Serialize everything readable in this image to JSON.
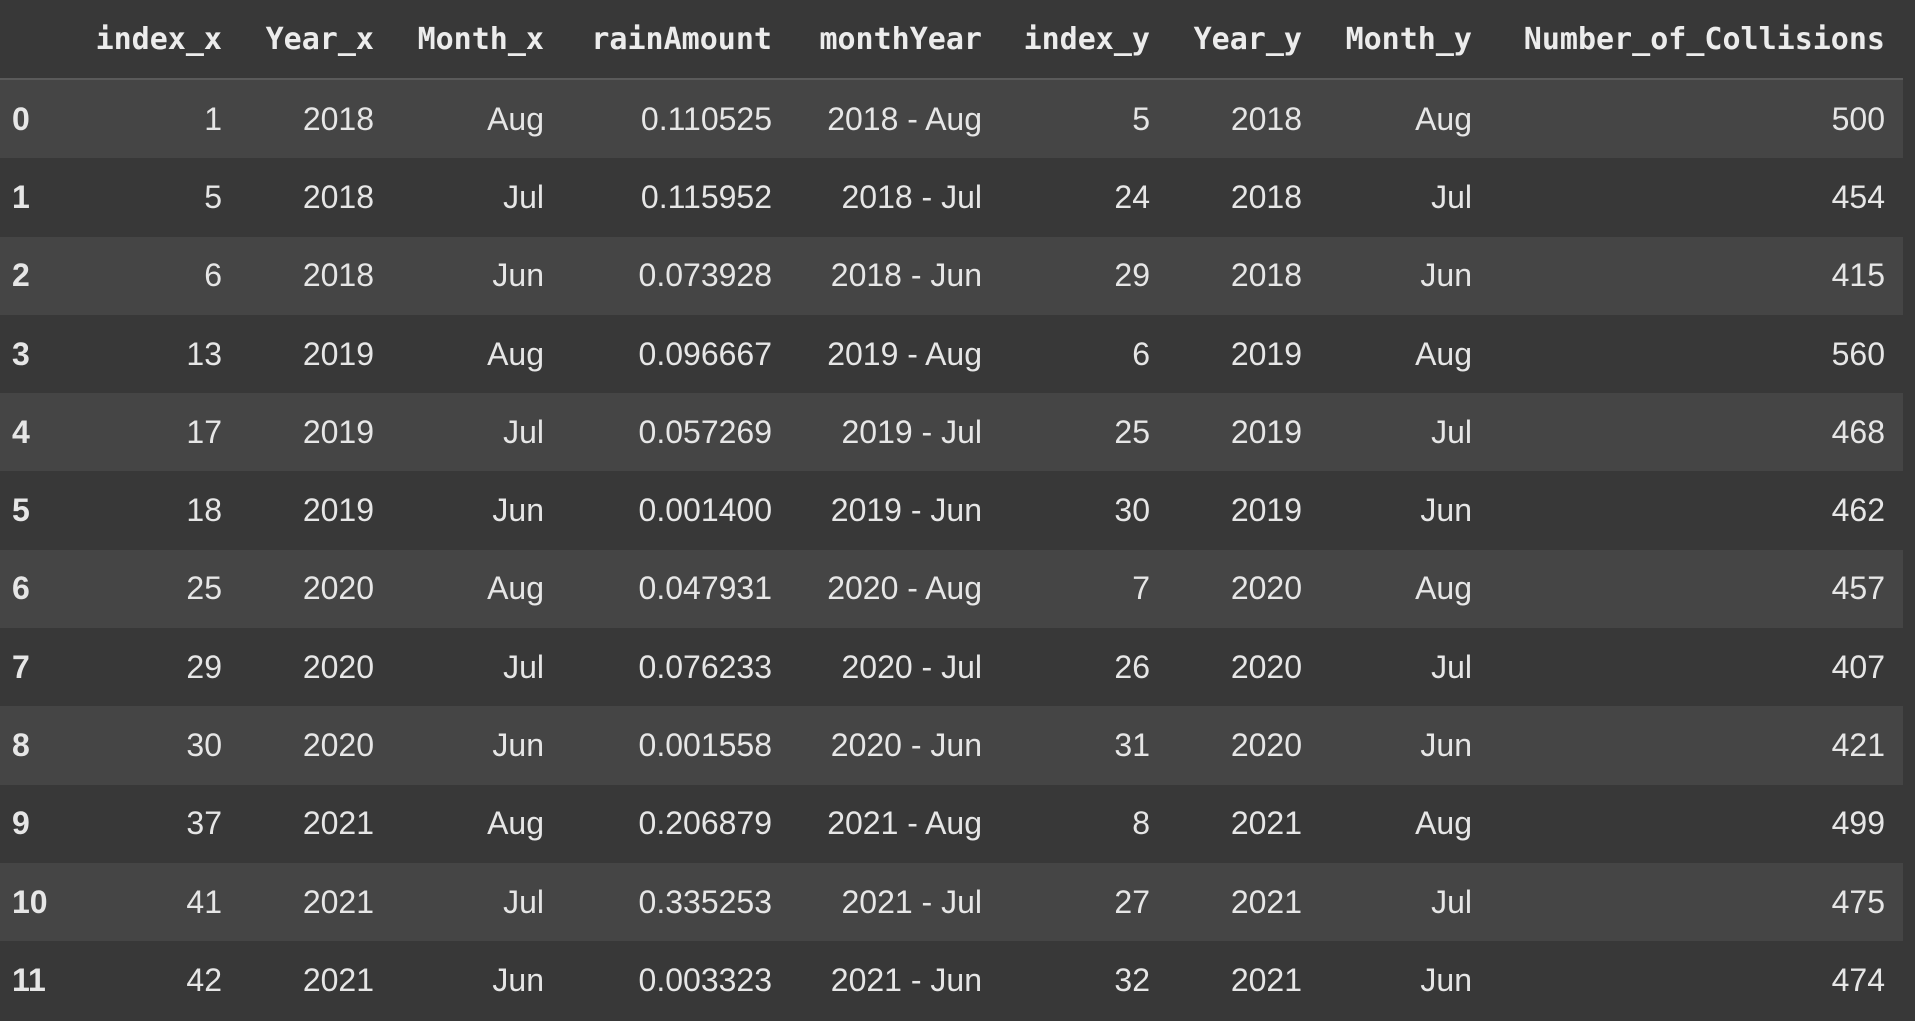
{
  "table": {
    "columns": [
      "",
      "index_x",
      "Year_x",
      "Month_x",
      "rainAmount",
      "monthYear",
      "index_y",
      "Year_y",
      "Month_y",
      "Number_of_Collisions"
    ],
    "rows": [
      {
        "idx": "0",
        "cells": [
          "1",
          "2018",
          "Aug",
          "0.110525",
          "2018 - Aug",
          "5",
          "2018",
          "Aug",
          "500"
        ]
      },
      {
        "idx": "1",
        "cells": [
          "5",
          "2018",
          "Jul",
          "0.115952",
          "2018 - Jul",
          "24",
          "2018",
          "Jul",
          "454"
        ]
      },
      {
        "idx": "2",
        "cells": [
          "6",
          "2018",
          "Jun",
          "0.073928",
          "2018 - Jun",
          "29",
          "2018",
          "Jun",
          "415"
        ]
      },
      {
        "idx": "3",
        "cells": [
          "13",
          "2019",
          "Aug",
          "0.096667",
          "2019 - Aug",
          "6",
          "2019",
          "Aug",
          "560"
        ]
      },
      {
        "idx": "4",
        "cells": [
          "17",
          "2019",
          "Jul",
          "0.057269",
          "2019 - Jul",
          "25",
          "2019",
          "Jul",
          "468"
        ]
      },
      {
        "idx": "5",
        "cells": [
          "18",
          "2019",
          "Jun",
          "0.001400",
          "2019 - Jun",
          "30",
          "2019",
          "Jun",
          "462"
        ]
      },
      {
        "idx": "6",
        "cells": [
          "25",
          "2020",
          "Aug",
          "0.047931",
          "2020 - Aug",
          "7",
          "2020",
          "Aug",
          "457"
        ]
      },
      {
        "idx": "7",
        "cells": [
          "29",
          "2020",
          "Jul",
          "0.076233",
          "2020 - Jul",
          "26",
          "2020",
          "Jul",
          "407"
        ]
      },
      {
        "idx": "8",
        "cells": [
          "30",
          "2020",
          "Jun",
          "0.001558",
          "2020 - Jun",
          "31",
          "2020",
          "Jun",
          "421"
        ]
      },
      {
        "idx": "9",
        "cells": [
          "37",
          "2021",
          "Aug",
          "0.206879",
          "2021 - Aug",
          "8",
          "2021",
          "Aug",
          "499"
        ]
      },
      {
        "idx": "10",
        "cells": [
          "41",
          "2021",
          "Jul",
          "0.335253",
          "2021 - Jul",
          "27",
          "2021",
          "Jul",
          "475"
        ]
      },
      {
        "idx": "11",
        "cells": [
          "42",
          "2021",
          "Jun",
          "0.003323",
          "2021 - Jun",
          "32",
          "2021",
          "Jun",
          "474"
        ]
      }
    ]
  }
}
